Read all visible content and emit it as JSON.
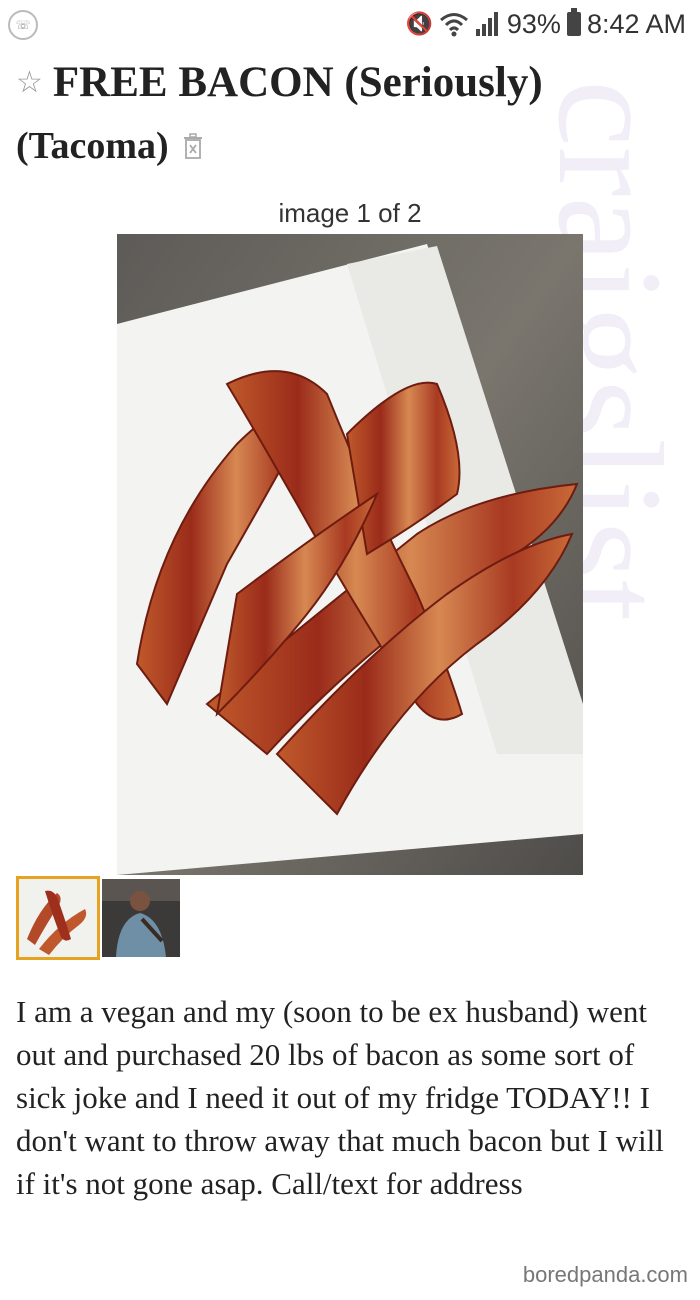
{
  "status_bar": {
    "battery_percent": "93%",
    "time": "8:42 AM",
    "icons": [
      "phone-app-icon",
      "mute-icon",
      "wifi-icon",
      "signal-icon",
      "battery-icon"
    ]
  },
  "post": {
    "title": "FREE BACON (Seriously)",
    "location": "(Tacoma)",
    "image_counter": "image 1 of 2",
    "selected_thumbnail_color": "#e5a321",
    "description": "I am a vegan and my (soon to be ex husband) went out and purchased 20 lbs of bacon as some sort of sick joke and I need it out of my fridge TODAY!! I don't want to throw away that much bacon but I will if it's not gone asap. Call/text for address"
  },
  "watermark_text": "craigslist",
  "credit": "boredpanda.com"
}
